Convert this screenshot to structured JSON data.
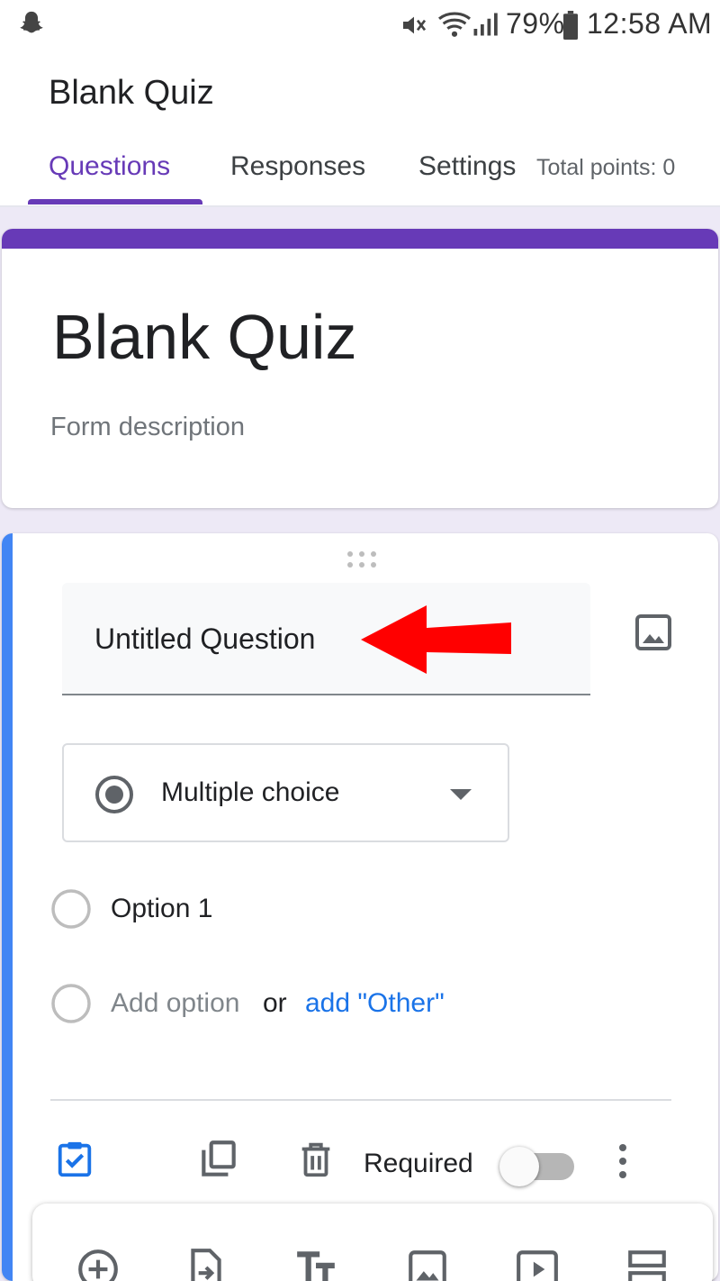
{
  "status_bar": {
    "battery": "79%",
    "time": "12:58 AM",
    "icons": [
      "snapchat-icon",
      "mute-icon",
      "wifi-icon",
      "signal-icon",
      "battery-icon"
    ]
  },
  "app": {
    "title": "Blank Quiz"
  },
  "tabs": [
    {
      "label": "Questions",
      "active": true
    },
    {
      "label": "Responses",
      "active": false
    },
    {
      "label": "Settings",
      "active": false
    }
  ],
  "total_points": "Total points: 0",
  "form": {
    "title": "Blank Quiz",
    "description_placeholder": "Form description"
  },
  "question": {
    "title": "Untitled Question",
    "type": "Multiple choice",
    "options": [
      "Option 1"
    ],
    "add_option": "Add option",
    "or_text": "or",
    "add_other": "add \"Other\"",
    "required_label": "Required",
    "required": false
  },
  "colors": {
    "accent": "#673ab7",
    "question_accent": "#4285f4",
    "link": "#1a73e8",
    "annotation": "#ff0000"
  }
}
